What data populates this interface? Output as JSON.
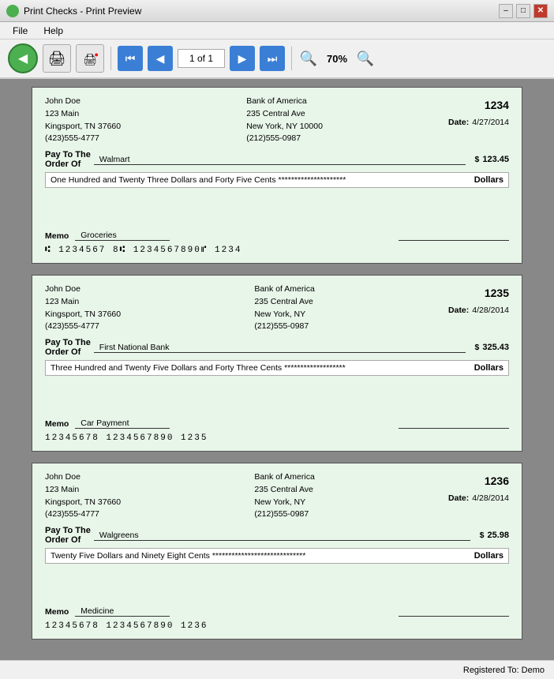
{
  "titleBar": {
    "title": "Print Checks - Print Preview",
    "minLabel": "–",
    "maxLabel": "□",
    "closeLabel": "✕"
  },
  "menuBar": {
    "items": [
      "File",
      "Help"
    ]
  },
  "toolbar": {
    "backLabel": "◀",
    "printLabel": "🖨",
    "pageInfo": "1 of 1",
    "zoomLabel": "70%",
    "zoomInLabel": "🔍",
    "zoomOutLabel": "🔍"
  },
  "checks": [
    {
      "from": {
        "name": "John Doe",
        "address1": "123 Main",
        "city": "Kingsport, TN 37660",
        "phone": "(423)555-4777"
      },
      "bank": {
        "name": "Bank of America",
        "address1": "235 Central Ave",
        "city": "New York, NY 10000",
        "phone": "(212)555-0987"
      },
      "number": "1234",
      "date": "4/27/2014",
      "payTo": "Walmart",
      "amount": "123.45",
      "amountWords": "One Hundred and Twenty Three Dollars and Forty Five Cents *********************",
      "memo": "Groceries",
      "micr": "⑆ 1234567 8⑆  1234567890⑈  1234"
    },
    {
      "from": {
        "name": "John Doe",
        "address1": "123 Main",
        "city": "Kingsport, TN 37660",
        "phone": "(423)555-4777"
      },
      "bank": {
        "name": "Bank of America",
        "address1": "235 Central Ave",
        "city": "New York, NY",
        "phone": "(212)555-0987"
      },
      "number": "1235",
      "date": "4/28/2014",
      "payTo": "First National Bank",
      "amount": "325.43",
      "amountWords": "Three Hundred and Twenty Five Dollars and Forty Three Cents *******************",
      "memo": "Car Payment",
      "micr": "12345678  1234567890  1235"
    },
    {
      "from": {
        "name": "John Doe",
        "address1": "123 Main",
        "city": "Kingsport, TN 37660",
        "phone": "(423)555-4777"
      },
      "bank": {
        "name": "Bank of America",
        "address1": "235 Central Ave",
        "city": "New York, NY",
        "phone": "(212)555-0987"
      },
      "number": "1236",
      "date": "4/28/2014",
      "payTo": "Walgreens",
      "amount": "25.98",
      "amountWords": "Twenty Five Dollars and Ninety Eight Cents *****************************",
      "memo": "Medicine",
      "micr": "12345678  1234567890  1236"
    }
  ],
  "statusBar": {
    "text": "Registered To: Demo"
  }
}
